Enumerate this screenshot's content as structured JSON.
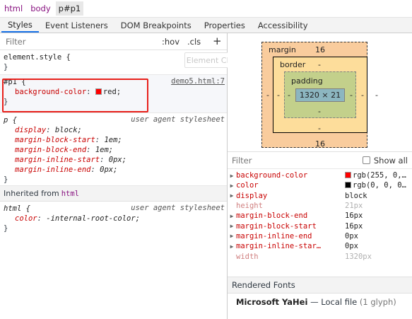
{
  "breadcrumb": [
    "html",
    "body",
    "p#p1"
  ],
  "tabs": [
    "Styles",
    "Event Listeners",
    "DOM Breakpoints",
    "Properties",
    "Accessibility"
  ],
  "styles_filter": {
    "placeholder": "Filter",
    "hov": ":hov",
    "cls": ".cls",
    "add": "+"
  },
  "tooltip": "Element Classes",
  "element_style": {
    "selector": "element.style {",
    "close": "}"
  },
  "rule_p1": {
    "selector": "#p1 {",
    "source": "demo5.html:7",
    "prop": "background-color",
    "value": "red;",
    "close": "}",
    "swatch": "#ff0000"
  },
  "rule_p": {
    "selector": "p {",
    "source": "user agent stylesheet",
    "props": [
      {
        "name": "display",
        "value": "block;"
      },
      {
        "name": "margin-block-start",
        "value": "1em;"
      },
      {
        "name": "margin-block-end",
        "value": "1em;"
      },
      {
        "name": "margin-inline-start",
        "value": "0px;"
      },
      {
        "name": "margin-inline-end",
        "value": "0px;"
      }
    ],
    "close": "}"
  },
  "inherited": {
    "label": "Inherited from",
    "tag": "html"
  },
  "rule_html": {
    "selector": "html {",
    "source": "user agent stylesheet",
    "prop": "color",
    "value": "-internal-root-color;",
    "close": "}"
  },
  "box_model": {
    "margin_label": "margin",
    "margin_top": "16",
    "margin_bottom": "16",
    "margin_left": "-",
    "margin_right": "-",
    "border_label": "border",
    "border_top": "-",
    "border_bottom": "-",
    "border_left": "-",
    "border_right": "-",
    "padding_label": "padding",
    "padding_top": "",
    "padding_bottom": "-",
    "padding_left": "-",
    "padding_right": "-",
    "content": "1320 × 21"
  },
  "computed_filter": {
    "placeholder": "Filter",
    "show_all": "Show all"
  },
  "computed": [
    {
      "name": "background-color",
      "value": "rgb(255, 0,…",
      "swatch": "#ff0000",
      "expandable": true,
      "dim": false
    },
    {
      "name": "color",
      "value": "rgb(0, 0, 0…",
      "swatch": "#000000",
      "expandable": true,
      "dim": false
    },
    {
      "name": "display",
      "value": "block",
      "expandable": true,
      "dim": false
    },
    {
      "name": "height",
      "value": "21px",
      "expandable": false,
      "dim": true
    },
    {
      "name": "margin-block-end",
      "value": "16px",
      "expandable": true,
      "dim": false
    },
    {
      "name": "margin-block-start",
      "value": "16px",
      "expandable": true,
      "dim": false
    },
    {
      "name": "margin-inline-end",
      "value": "0px",
      "expandable": true,
      "dim": false
    },
    {
      "name": "margin-inline-star…",
      "value": "0px",
      "expandable": true,
      "dim": false
    },
    {
      "name": "width",
      "value": "1320px",
      "expandable": false,
      "dim": true
    }
  ],
  "rendered_fonts": {
    "title": "Rendered Fonts",
    "font": "Microsoft YaHei",
    "dash": "—",
    "source": "Local file",
    "count": "(1 glyph)"
  },
  "colors": {
    "accent": "#1a73e8",
    "prop_name": "#c80000",
    "tag": "#881280",
    "highlight_box": "#e8201b"
  }
}
